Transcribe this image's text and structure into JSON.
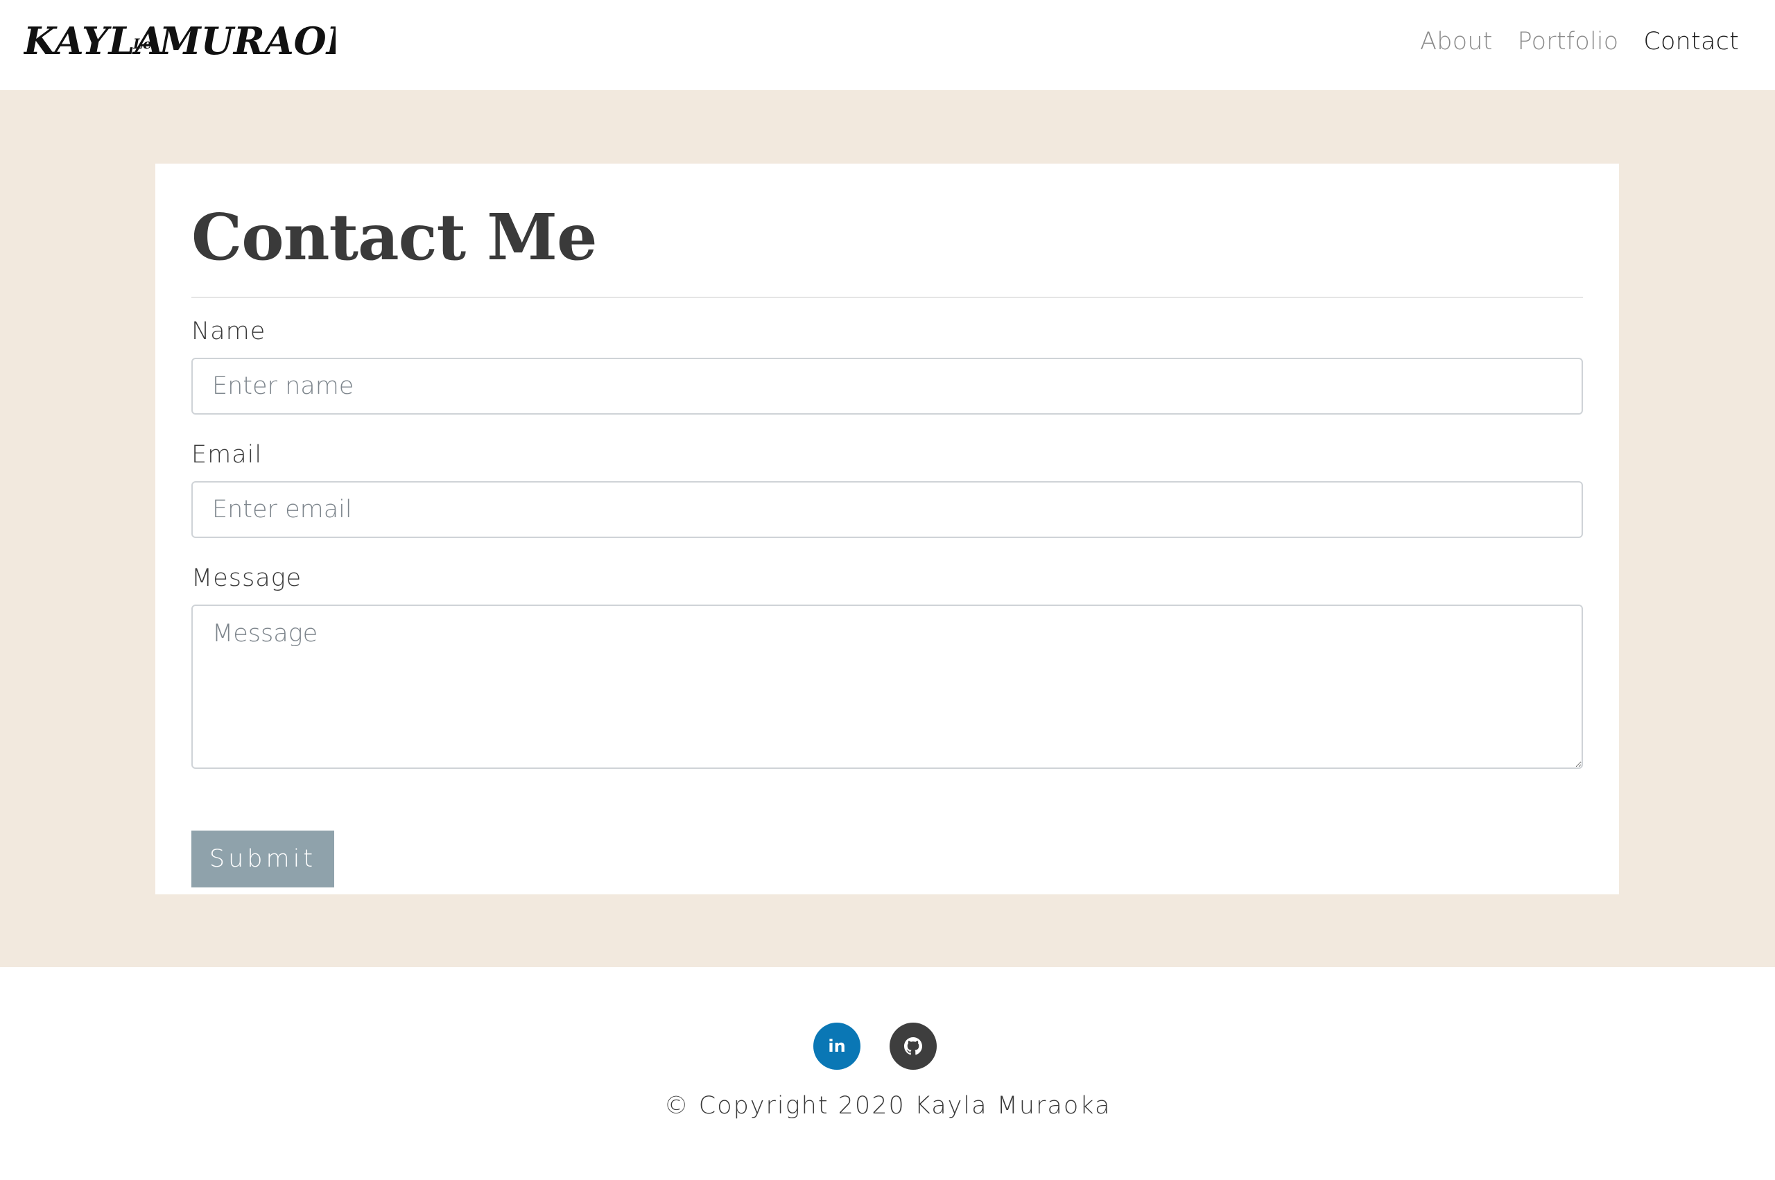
{
  "header": {
    "logo_main": "KAYLA",
    "logo_middle": "Lei",
    "logo_last": "MURAOKA",
    "nav": {
      "about": "About",
      "portfolio": "Portfolio",
      "contact": "Contact"
    },
    "active_nav": "Contact"
  },
  "contact": {
    "title": "Contact Me",
    "name_label": "Name",
    "name_placeholder": "Enter name",
    "email_label": "Email",
    "email_placeholder": "Enter email",
    "message_label": "Message",
    "message_placeholder": "Message",
    "submit_label": "Submit"
  },
  "footer": {
    "linkedin_icon": "linkedin-icon",
    "linkedin_text": "in",
    "github_icon": "github-icon",
    "copyright": "© Copyright 2020 Kayla Muraoka"
  },
  "colors": {
    "background_band": "#f2e9de",
    "submit_button": "#8fa2ab",
    "linkedin": "#0a77b5",
    "github": "#3e3e3e"
  }
}
